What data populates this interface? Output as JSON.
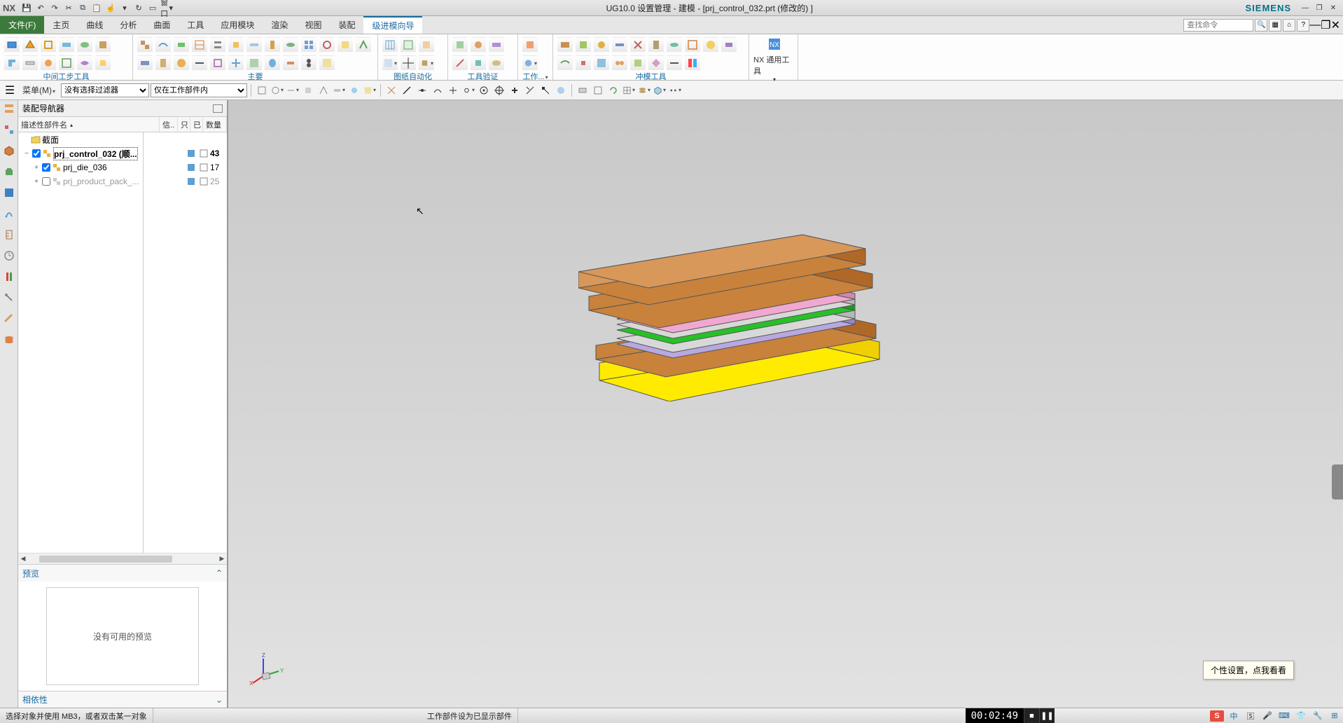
{
  "titlebar": {
    "nx": "NX",
    "title": "UG10.0 设置管理 - 建模 - [prj_control_032.prt   (修改的)   ]",
    "brand": "SIEMENS",
    "window_label": "窗口"
  },
  "menubar": {
    "file": "文件(F)",
    "tabs": [
      "主页",
      "曲线",
      "分析",
      "曲面",
      "工具",
      "应用模块",
      "渲染",
      "视图",
      "装配",
      "级进模向导"
    ],
    "active_tab": 9,
    "search_placeholder": "查找命令"
  },
  "ribbon": {
    "groups": [
      {
        "label": "中间工步工具",
        "icons": 12
      },
      {
        "label": "主要",
        "icons": 24
      },
      {
        "label": "图纸自动化",
        "icons": 4
      },
      {
        "label": "工具验证",
        "icons": 6
      },
      {
        "label": "工作...",
        "icons": 2
      },
      {
        "label": "冲模工具",
        "icons": 18
      }
    ],
    "big_button": "NX 通用工具"
  },
  "selbar": {
    "menu": "菜单(M)",
    "filter1": "没有选择过滤器",
    "filter2": "仅在工作部件内"
  },
  "navigator": {
    "title": "装配导航器",
    "columns": {
      "name": "描述性部件名",
      "info": "信..",
      "r": "只",
      "c": "已",
      "count": "数量"
    },
    "section_label": "截面",
    "rows": [
      {
        "indent": 0,
        "expanded": true,
        "checked": true,
        "name": "prj_control_032  (顺...",
        "count": "43",
        "bold": true,
        "selected": true
      },
      {
        "indent": 1,
        "expanded": false,
        "checked": true,
        "name": "prj_die_036",
        "count": "17"
      },
      {
        "indent": 1,
        "expanded": false,
        "checked": false,
        "name": "prj_product_pack_...",
        "count": "25",
        "gray": true
      }
    ],
    "preview_label": "预览",
    "preview_empty": "没有可用的预览",
    "deps_label": "相依性"
  },
  "viewport": {
    "tooltip": "个性设置，点我看看"
  },
  "statusbar": {
    "left": "选择对象并使用 MB3，或者双击某一对象",
    "center": "工作部件设为已显示部件",
    "timer": "00:02:49",
    "ime_cn": "中"
  }
}
